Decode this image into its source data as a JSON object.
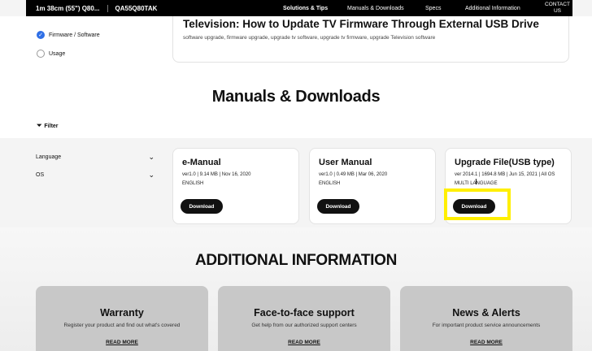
{
  "topnav": {
    "model": "1m 38cm (55\") Q80...",
    "code": "QA55Q80TAK",
    "items": [
      "Solutions & Tips",
      "Manuals & Downloads",
      "Specs",
      "Additional Information"
    ],
    "contact_line1": "CONTACT",
    "contact_line2": "US"
  },
  "sidebar_top": {
    "firmware": "Firmware / Software",
    "usage": "Usage"
  },
  "article": {
    "title": "Television: How to Update TV Firmware Through External USB Drive",
    "tags": "software upgrade, firmware upgrade, upgrade tv software, upgrade tv firmware, upgrade Television software"
  },
  "manuals": {
    "heading": "Manuals & Downloads",
    "filter_label": "Filter",
    "filters": [
      "Language",
      "OS"
    ],
    "cards": [
      {
        "title": "e-Manual",
        "meta": "ver1.0 | 9.14 MB | Nov 16, 2020",
        "lang": "ENGLISH",
        "button": "Download"
      },
      {
        "title": "User Manual",
        "meta": "ver1.0 | 0.49 MB | Mar 06, 2020",
        "lang": "ENGLISH",
        "button": "Download"
      },
      {
        "title": "Upgrade File(USB type)",
        "meta": "ver 2014.1 | 1694.8 MB | Jun 15, 2021 | All OS",
        "lang": "MULTI LANGUAGE",
        "button": "Download"
      }
    ]
  },
  "additional": {
    "heading": "ADDITIONAL INFORMATION",
    "cards": [
      {
        "title": "Warranty",
        "desc": "Register your product and find out what's covered",
        "more": "READ MORE"
      },
      {
        "title": "Face-to-face support",
        "desc": "Get help from our authorized support centers",
        "more": "READ MORE"
      },
      {
        "title": "News & Alerts",
        "desc": "For important product service announcements",
        "more": "READ MORE"
      }
    ]
  },
  "colors": {
    "nav_bg": "#000000",
    "accent_check": "#2f6fe6",
    "highlight": "#ffef00",
    "button_bg": "#111111"
  }
}
